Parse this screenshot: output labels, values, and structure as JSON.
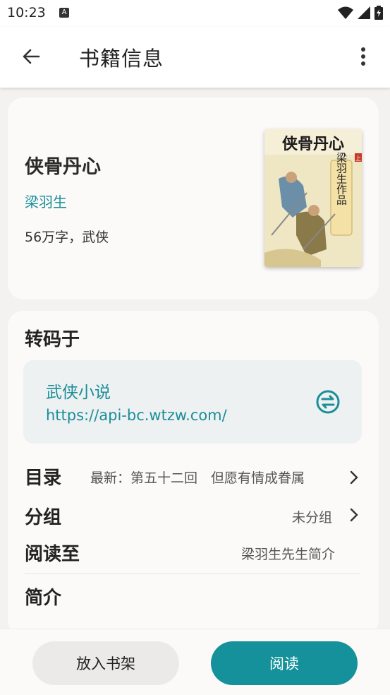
{
  "status": {
    "time": "10:23",
    "badge": "A"
  },
  "header": {
    "title": "书籍信息"
  },
  "book": {
    "title": "侠骨丹心",
    "author": "梁羽生",
    "meta": "56万字，武侠",
    "cover_title": "侠骨丹心",
    "cover_author": "梁羽生作品",
    "cover_vol": "上"
  },
  "source": {
    "section_title": "转码于",
    "name": "武侠小说",
    "url": "https://api-bc.wtzw.com/"
  },
  "rows": {
    "toc_label": "目录",
    "toc_value": "最新：第五十二回　但愿有情成眷属",
    "group_label": "分组",
    "group_value": "未分组",
    "progress_label": "阅读至",
    "progress_value": "梁羽生先生简介",
    "intro_label": "简介"
  },
  "actions": {
    "shelf": "放入书架",
    "read": "阅读"
  },
  "colors": {
    "accent": "#14919a",
    "link": "#1b8e98"
  }
}
